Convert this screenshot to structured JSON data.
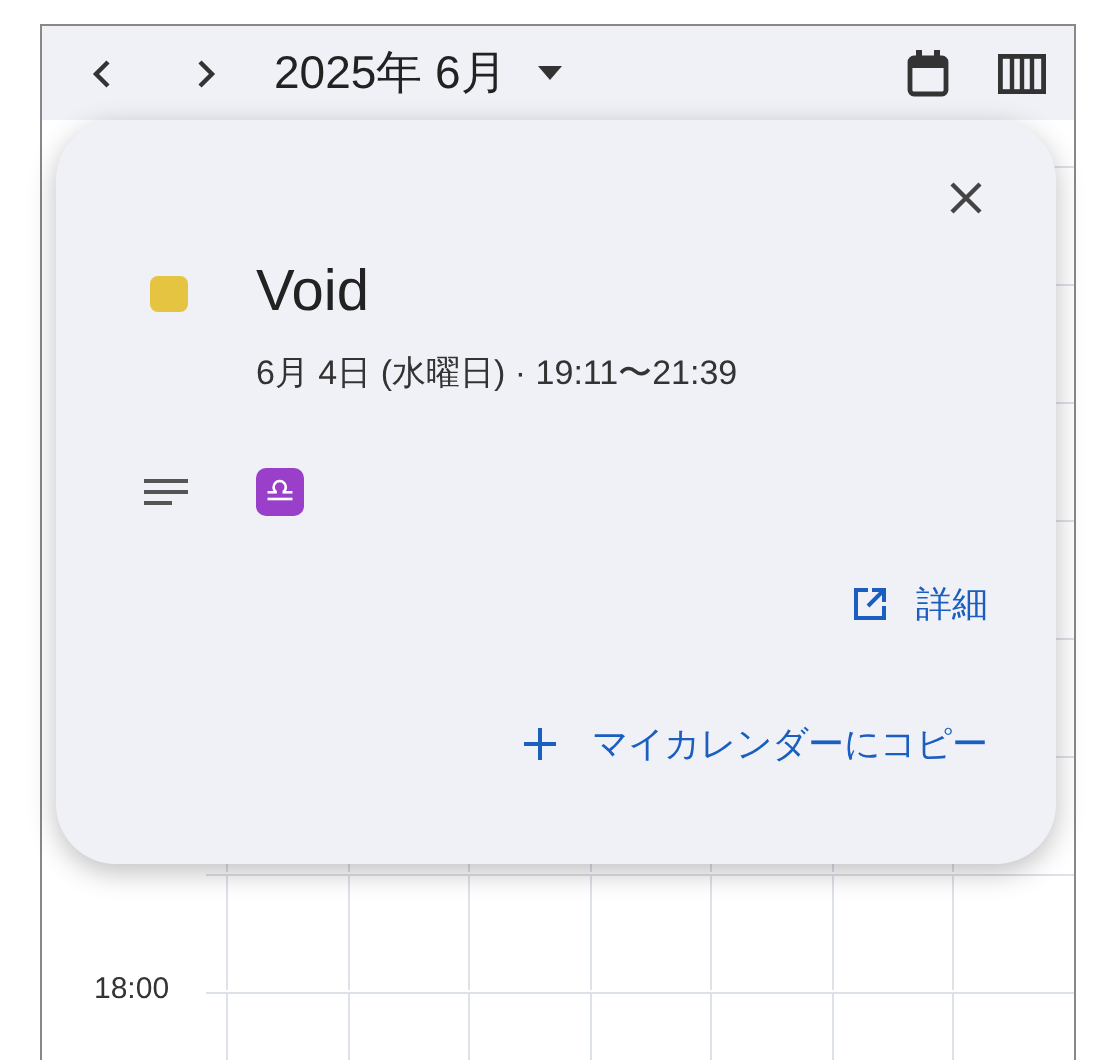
{
  "header": {
    "title": "2025年 6月"
  },
  "grid": {
    "time_labels": [
      "18:00"
    ]
  },
  "event_popup": {
    "title": "Void",
    "color": "#e4c441",
    "when": "6月 4日 (水曜日) · 19:11〜21:39",
    "description": "♎",
    "details_link": "詳細",
    "copy_button": "マイカレンダーにコピー"
  }
}
